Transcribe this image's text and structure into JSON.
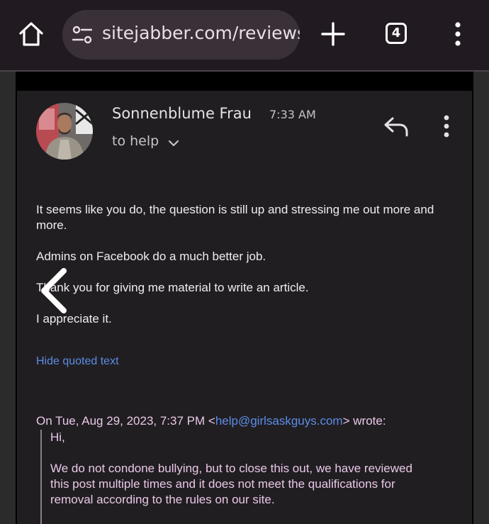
{
  "browser": {
    "url": "sitejabber.com/reviews",
    "tab_count": "4",
    "icons": {
      "home": "home-icon",
      "site_settings": "tune-icon",
      "new_tab": "plus-icon",
      "menu": "more-vert-icon"
    }
  },
  "email": {
    "sender": "Sonnenblume Frau",
    "time": "7:33 AM",
    "recipient": "to help",
    "paragraphs": [
      "It seems like you do, the question is still up and stressing me out more and more.",
      "Admins on Facebook do a much better job.",
      "Thank you for giving me material to write an article.",
      "I appreciate it."
    ],
    "hide_quoted_label": "Hide quoted text",
    "quote_header": {
      "prefix": "On Tue, Aug 29, 2023, 7:37 PM <",
      "email": "help@girlsaskguys.com",
      "suffix": "> wrote:"
    },
    "quoted_paragraphs": [
      "Hi,",
      "We do not condone bullying, but to close this out, we have reviewed this post multiple times and it does not meet the qualifications for removal according to the rules on our site."
    ]
  },
  "colors": {
    "browser_bg": "#221a21",
    "url_pill": "#3a3038",
    "email_bg": "#211e22",
    "link": "#5b8de6",
    "quoted_text": "#e8c8e6"
  }
}
